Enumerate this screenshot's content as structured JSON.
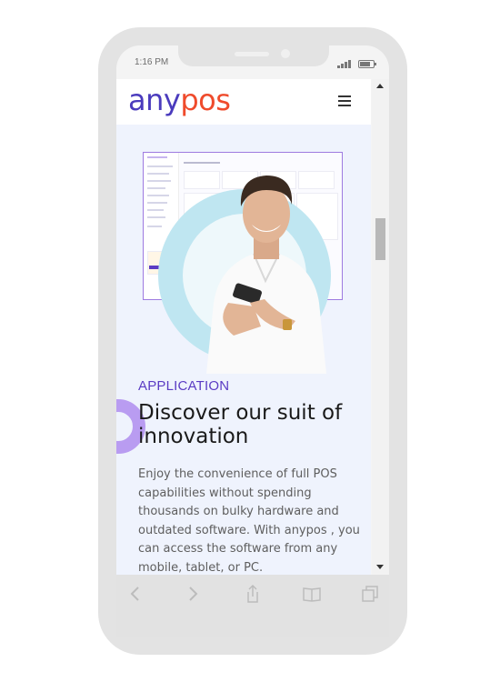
{
  "status_bar": {
    "time": "1:16 PM"
  },
  "navbar": {
    "logo_any": "any",
    "logo_pos": "pos",
    "menu_icon": "hamburger-menu-icon"
  },
  "hero": {
    "image": "man-smiling-at-phone-with-dashboard-screenshot"
  },
  "section": {
    "label": "APPLICATION",
    "heading": "Discover our suit of innovation",
    "body": "Enjoy the convenience of full POS capabilities without spending thousands on bulky hardware and outdated software. With anypos , you can access the software from any mobile, tablet, or PC."
  },
  "toolbar": {
    "back_icon": "chevron-left-icon",
    "forward_icon": "chevron-right-icon",
    "share_icon": "share-icon",
    "bookmarks_icon": "book-icon",
    "tabs_icon": "tabs-icon"
  },
  "colors": {
    "brand_purple": "#4a3bbd",
    "brand_orange": "#ef4b2c",
    "section_label": "#5b3cc4",
    "page_bg": "#eff3fd",
    "accent_ring": "#b99cf1"
  }
}
